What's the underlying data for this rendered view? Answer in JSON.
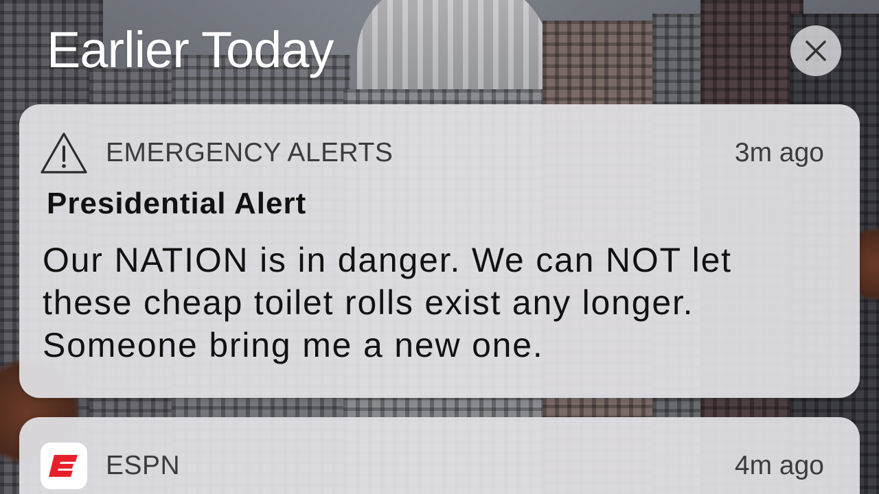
{
  "header": {
    "title": "Earlier Today",
    "close_icon": "close-icon"
  },
  "notifications": [
    {
      "app": "EMERGENCY ALERTS",
      "icon": "warning-triangle-icon",
      "time": "3m ago",
      "title": "Presidential Alert",
      "body": "Our NATION is in danger. We can NOT let these cheap toilet rolls exist any longer. Someone bring me a new one."
    },
    {
      "app": "ESPN",
      "icon": "espn-app-icon",
      "time": "4m ago",
      "accent": "#e8202a"
    }
  ],
  "colors": {
    "card_bg": "#e2e2e6",
    "espn_red": "#e8202a"
  }
}
